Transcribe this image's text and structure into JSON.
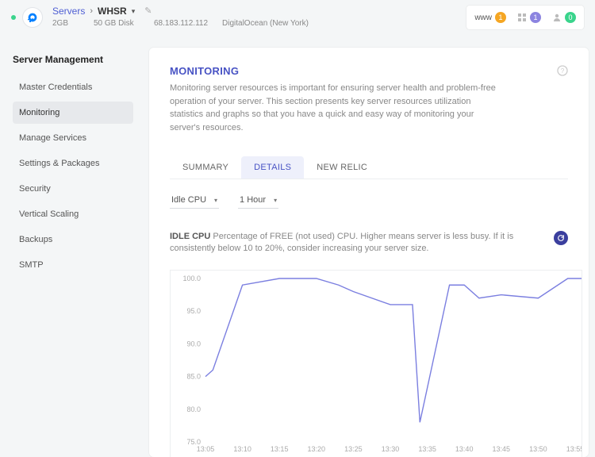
{
  "header": {
    "breadcrumb_link": "Servers",
    "server_name": "WHSR",
    "ram": "2GB",
    "disk": "50 GB Disk",
    "ip": "68.183.112.112",
    "provider": "DigitalOcean (New York)"
  },
  "topright": {
    "www_label": "www",
    "www_badge": "1",
    "app_badge": "1",
    "user_badge": "0"
  },
  "sidebar": {
    "title": "Server Management",
    "items": [
      "Master Credentials",
      "Monitoring",
      "Manage Services",
      "Settings & Packages",
      "Security",
      "Vertical Scaling",
      "Backups",
      "SMTP"
    ],
    "active_index": 1
  },
  "panel": {
    "title": "MONITORING",
    "description": "Monitoring server resources is important for ensuring server health and problem-free operation of your server. This section presents key server resources utilization statistics and graphs so that you have a quick and easy way of monitoring your server's resources."
  },
  "tabs": [
    "SUMMARY",
    "DETAILS",
    "NEW RELIC"
  ],
  "tabs_active_index": 1,
  "selectors": {
    "metric": "Idle CPU",
    "range": "1 Hour"
  },
  "metric": {
    "title": "IDLE CPU",
    "desc": "Percentage of FREE (not used) CPU. Higher means server is less busy. If it is consistently below 10 to 20%, consider increasing your server size."
  },
  "chart_data": {
    "type": "line",
    "title": "",
    "xlabel": "",
    "ylabel": "",
    "ylim": [
      75,
      100
    ],
    "y_ticks": [
      75.0,
      80.0,
      85.0,
      90.0,
      95.0,
      100.0
    ],
    "x_ticks": [
      "13:05",
      "13:10",
      "13:15",
      "13:20",
      "13:25",
      "13:30",
      "13:35",
      "13:40",
      "13:45",
      "13:50",
      "13:55"
    ],
    "series": [
      {
        "name": "Idle CPU",
        "x": [
          "13:05",
          "13:06",
          "13:10",
          "13:15",
          "13:20",
          "13:23",
          "13:25",
          "13:30",
          "13:33",
          "13:34",
          "13:38",
          "13:40",
          "13:42",
          "13:45",
          "13:50",
          "13:54",
          "13:57"
        ],
        "values": [
          85.0,
          86.0,
          99.0,
          100.0,
          100.0,
          99.0,
          98.0,
          96.0,
          96.0,
          78.0,
          99.0,
          99.0,
          97.0,
          97.5,
          97.0,
          100.0,
          100.0
        ]
      }
    ]
  }
}
